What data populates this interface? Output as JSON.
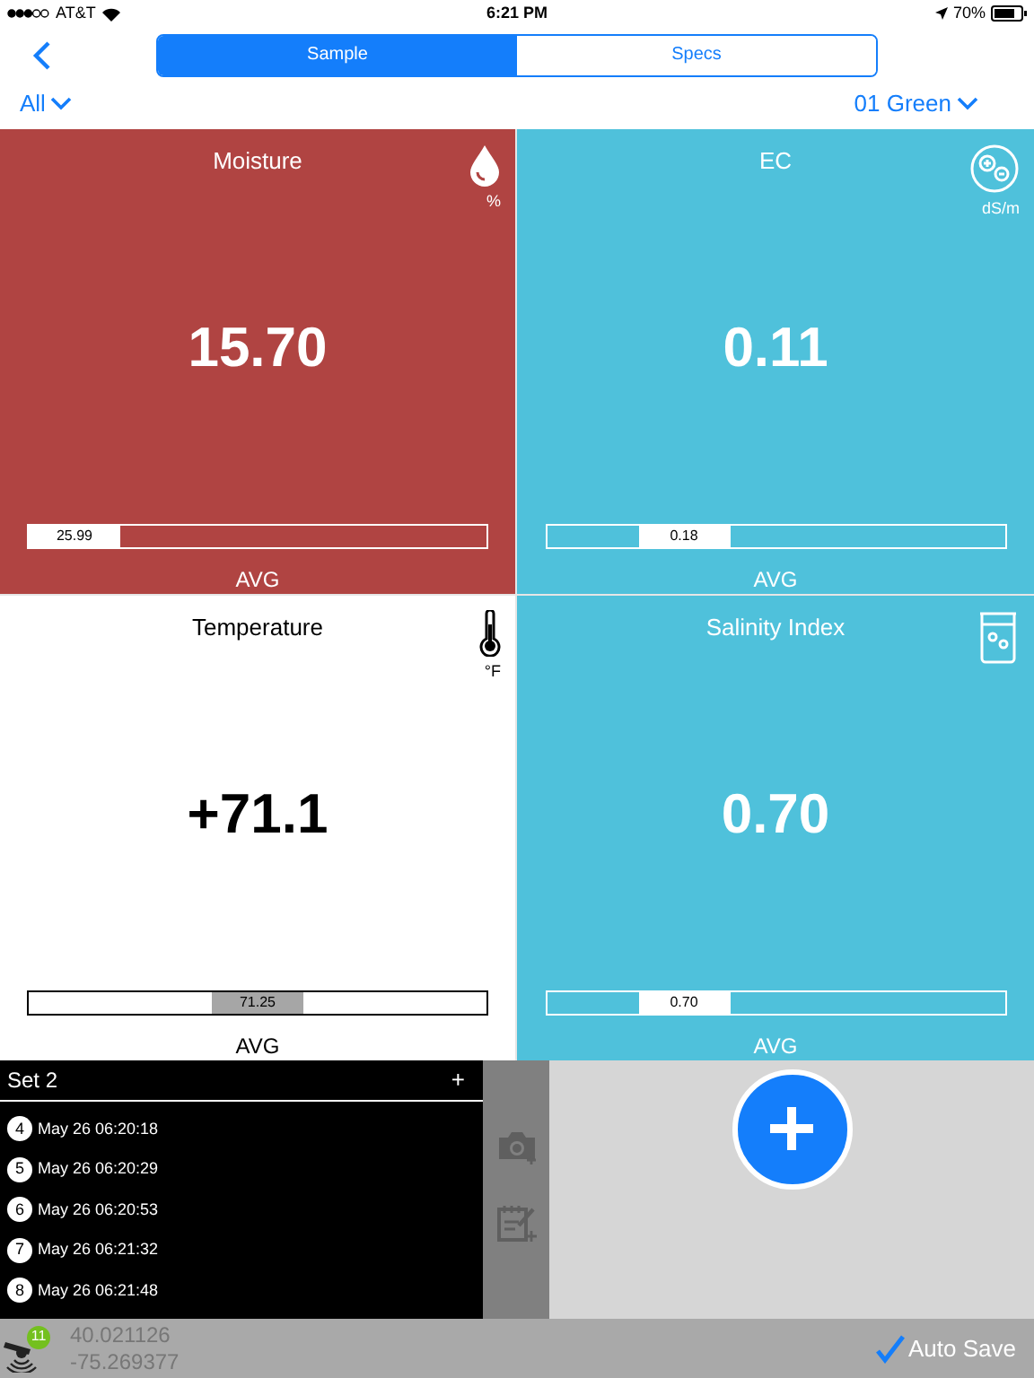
{
  "status_bar": {
    "carrier": "AT&T",
    "time": "6:21 PM",
    "battery": "70%"
  },
  "segments": [
    {
      "label": "Sample",
      "selected": true
    },
    {
      "label": "Specs",
      "selected": false
    }
  ],
  "filter": {
    "label": "All"
  },
  "selector": {
    "label": "01 Green"
  },
  "tiles": [
    {
      "kind": "drop",
      "title": "Moisture",
      "unit": "%",
      "value": "15.70",
      "avg_value": "25.99",
      "scale": [
        {
          "selected": true
        },
        {
          "selected": false
        },
        {
          "selected": false
        },
        {
          "selected": false
        },
        {
          "selected": false
        }
      ],
      "avg_label": "AVG",
      "color": "#b04442"
    },
    {
      "kind": "ec",
      "title": "EC",
      "unit": "dS/m",
      "value": "0.11",
      "avg_value": "0.18",
      "scale": [
        {
          "selected": false
        },
        {
          "selected": true
        },
        {
          "selected": false
        },
        {
          "selected": false
        },
        {
          "selected": false
        }
      ],
      "avg_label": "AVG",
      "color": "#4fc1db"
    },
    {
      "kind": "thermometer",
      "title": "Temperature",
      "unit": "°F",
      "value": "+71.1",
      "avg_value": "71.25",
      "scale": [
        {
          "selected": false
        },
        {
          "selected": false
        },
        {
          "selected": true
        },
        {
          "selected": false
        },
        {
          "selected": false
        }
      ],
      "avg_label": "AVG",
      "color": "#ffffff"
    },
    {
      "kind": "beaker",
      "title": "Salinity Index",
      "value": "0.70",
      "avg_value": "0.70",
      "scale": [
        {
          "selected": false
        },
        {
          "selected": true
        },
        {
          "selected": false
        },
        {
          "selected": false
        },
        {
          "selected": false
        }
      ],
      "avg_label": "AVG",
      "color": "#4fc1db"
    }
  ],
  "set_panel": {
    "title": "Set 2",
    "add": "+",
    "readings": [
      {
        "number": "4",
        "time": "May 26 06:20:18"
      },
      {
        "number": "5",
        "time": "May 26 06:20:29"
      },
      {
        "number": "6",
        "time": "May 26 06:20:53"
      },
      {
        "number": "7",
        "time": "May 26 06:21:32"
      },
      {
        "number": "8",
        "time": "May 26 06:21:48"
      }
    ]
  },
  "footer": {
    "satellites": "11",
    "latitude": "40.021126",
    "longitude": "-75.269377",
    "auto_save": {
      "label": "Auto Save",
      "checked": true
    }
  }
}
